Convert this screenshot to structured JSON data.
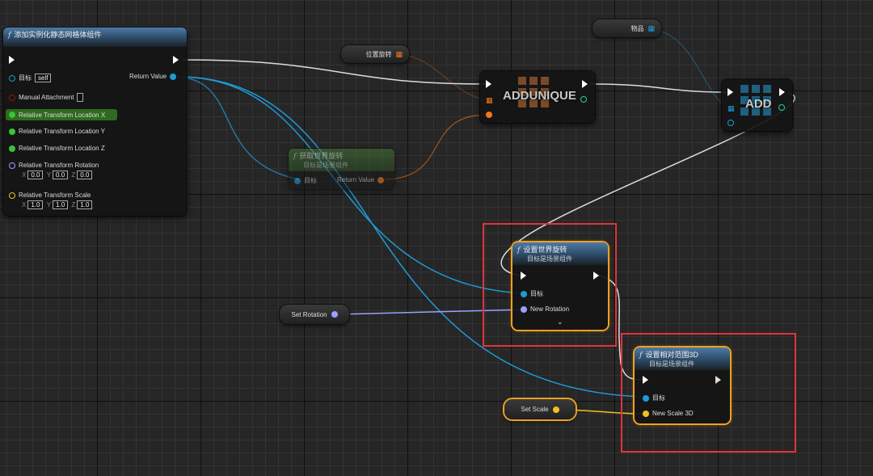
{
  "colors": {
    "exec": "#ffffff",
    "object": "#1e9ad6",
    "float": "#3ac43a",
    "rotator": "#9aa0ff",
    "vector": "#f0c020",
    "transform": "#f07820",
    "highlight": "#e0343c",
    "selected": "#f0a020"
  },
  "node_add_ism": {
    "title": "添加实例化静态网格体组件",
    "target_label": "目标",
    "target_value": "self",
    "return_label": "Return Value",
    "manual_attachment": "Manual Attachment",
    "loc_x": "Relative Transform Location X",
    "loc_y": "Relative Transform Location Y",
    "loc_z": "Relative Transform Location Z",
    "rotation": "Relative Transform Rotation",
    "rot_x_lbl": "X",
    "rot_x": "0.0",
    "rot_y_lbl": "Y",
    "rot_y": "0.0",
    "rot_z_lbl": "Z",
    "rot_z": "0.0",
    "scale": "Relative Transform Scale",
    "scl_x_lbl": "X",
    "scl_x": "1.0",
    "scl_y_lbl": "Y",
    "scl_y": "1.0",
    "scl_z_lbl": "Z",
    "scl_z": "1.0"
  },
  "var_position_rotation": {
    "label": "位置旋转"
  },
  "var_item": {
    "label": "物品"
  },
  "node_addunique": {
    "label": "ADDUNIQUE"
  },
  "node_add": {
    "label": "ADD"
  },
  "node_get_world_rot": {
    "title": "获取世界旋转",
    "subtitle": "目标是场景组件",
    "target_label": "目标",
    "return_label": "Return Value"
  },
  "node_set_world_rot": {
    "title": "设置世界旋转",
    "subtitle": "目标是场景组件",
    "target_label": "目标",
    "new_rotation_label": "New Rotation",
    "expand_icon": "chevron-down-icon"
  },
  "node_set_rel_scale": {
    "title": "设置相对范围3D",
    "subtitle": "目标是场景组件",
    "target_label": "目标",
    "new_scale_label": "New Scale 3D"
  },
  "var_set_rotation": {
    "label": "Set Rotation"
  },
  "var_set_scale": {
    "label": "Set Scale"
  }
}
